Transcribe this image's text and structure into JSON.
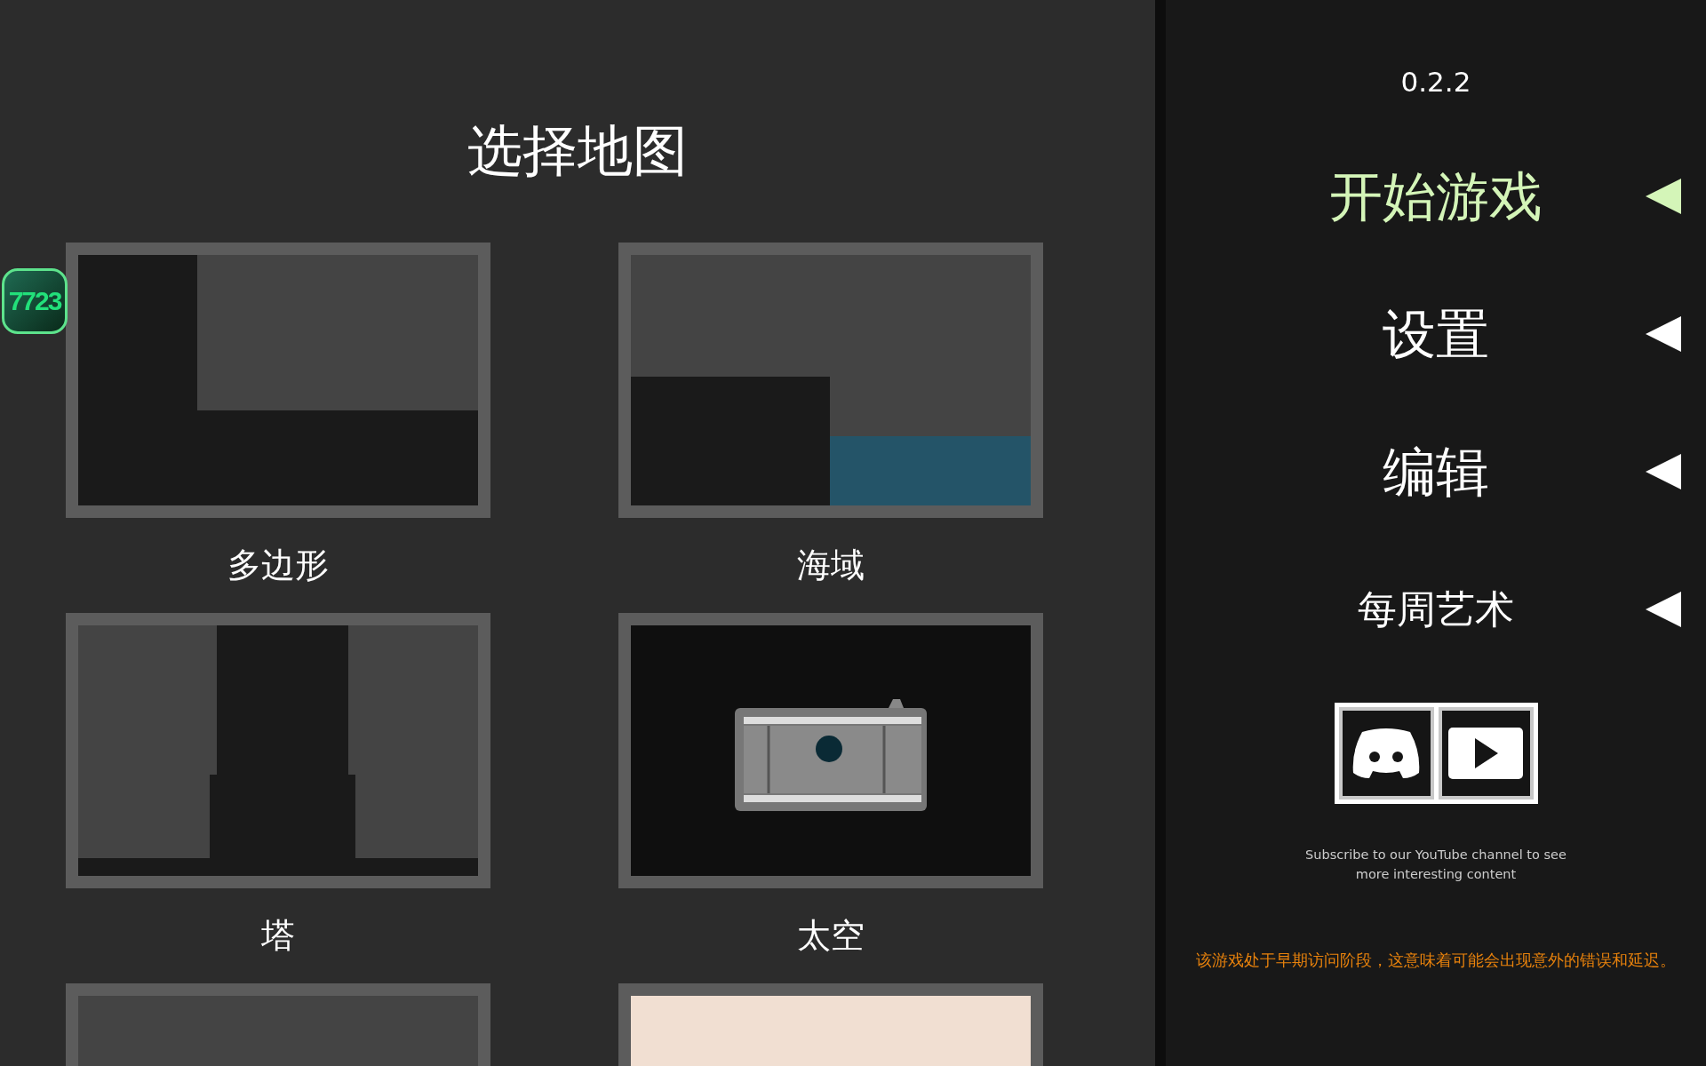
{
  "badge": {
    "text": "7723"
  },
  "map_select": {
    "title": "选择地图",
    "maps": [
      {
        "kind": "polygon",
        "label": "多边形"
      },
      {
        "kind": "sea",
        "label": "海域"
      },
      {
        "kind": "tower",
        "label": "塔"
      },
      {
        "kind": "space",
        "label": "太空"
      },
      {
        "kind": "grid"
      },
      {
        "kind": "blank"
      }
    ]
  },
  "side_menu": {
    "version": "0.2.2",
    "items": [
      {
        "label": "开始游戏",
        "selected": true
      },
      {
        "label": "设置",
        "selected": false
      },
      {
        "label": "编辑",
        "selected": false
      },
      {
        "label": "每周艺术",
        "selected": false
      }
    ],
    "social_caption": "Subscribe to our YouTube channel to see more interesting content",
    "notice": "该游戏处于早期访问阶段，这意味着可能会出现意外的错误和延迟。"
  }
}
